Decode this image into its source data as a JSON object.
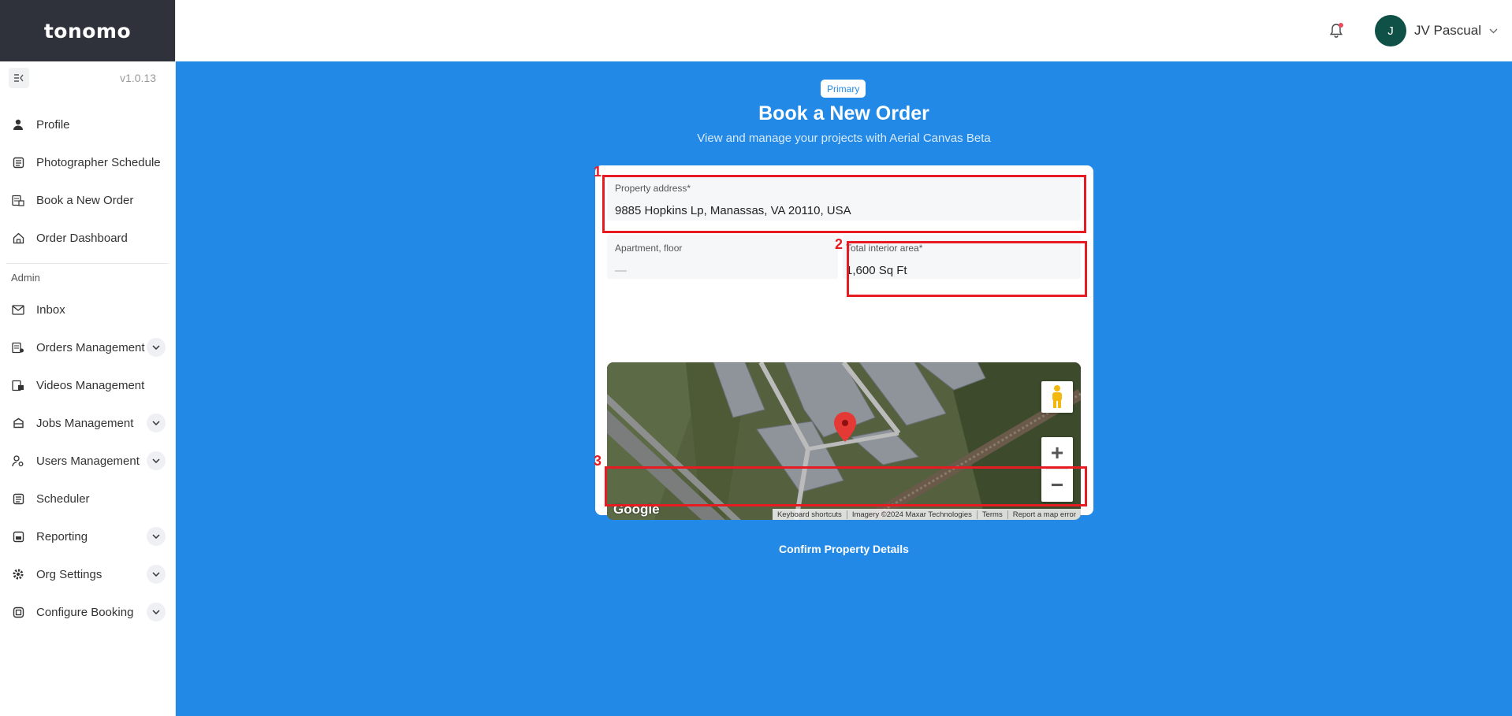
{
  "brand": {
    "logo_text": "tonomo",
    "version": "v1.0.13"
  },
  "sidebar": {
    "items": [
      {
        "label": "Profile",
        "icon": "user-icon"
      },
      {
        "label": "Photographer Schedule",
        "icon": "schedule-icon"
      },
      {
        "label": "Book a New Order",
        "icon": "book-order-icon"
      },
      {
        "label": "Order Dashboard",
        "icon": "home-icon"
      }
    ],
    "admin_label": "Admin",
    "admin_items": [
      {
        "label": "Inbox",
        "icon": "mail-icon"
      },
      {
        "label": "Orders Management",
        "icon": "orders-icon",
        "expandable": true
      },
      {
        "label": "Videos Management",
        "icon": "video-icon"
      },
      {
        "label": "Jobs Management",
        "icon": "jobs-icon",
        "expandable": true
      },
      {
        "label": "Users Management",
        "icon": "users-icon",
        "expandable": true
      },
      {
        "label": "Scheduler",
        "icon": "scheduler-icon"
      },
      {
        "label": "Reporting",
        "icon": "report-icon",
        "expandable": true
      },
      {
        "label": "Org Settings",
        "icon": "gear-icon",
        "expandable": true
      },
      {
        "label": "Configure Booking",
        "icon": "configure-icon",
        "expandable": true
      }
    ]
  },
  "header": {
    "avatar_initial": "J",
    "user_name": "JV Pascual"
  },
  "main": {
    "badge": "Primary",
    "title": "Book a New Order",
    "subtitle": "View and manage your projects with Aerial Canvas Beta",
    "form": {
      "address_label": "Property address*",
      "address_value": "9885 Hopkins Lp, Manassas, VA 20110, USA",
      "apartment_label": "Apartment, floor",
      "apartment_placeholder": "—",
      "area_label": "Total interior area*",
      "area_value": "1,600 Sq Ft",
      "confirm_label": "Confirm Property Details"
    },
    "map": {
      "logo": "Google",
      "attribution": [
        "Keyboard shortcuts",
        "Imagery ©2024 Maxar Technologies",
        "Terms",
        "Report a map error"
      ]
    },
    "annotations": [
      "1",
      "2",
      "3"
    ]
  },
  "colors": {
    "accent": "#228ae6",
    "sidebar_header": "#2f323a",
    "highlight": "#e61c22",
    "avatar": "#0f5147"
  }
}
